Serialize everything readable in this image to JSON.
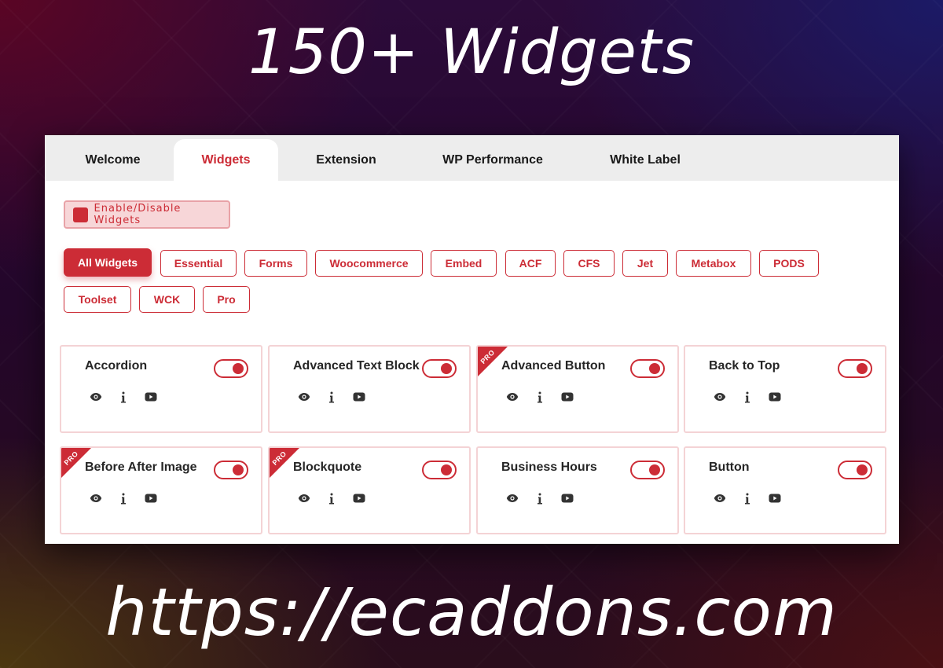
{
  "hero": {
    "title": "150+ Widgets",
    "url": "https://ecaddons.com"
  },
  "tabs": [
    {
      "label": "Welcome",
      "active": false
    },
    {
      "label": "Widgets",
      "active": true
    },
    {
      "label": "Extension",
      "active": false
    },
    {
      "label": "WP Performance",
      "active": false
    },
    {
      "label": "White Label",
      "active": false
    }
  ],
  "toolbar": {
    "enable_disable_label": "Enable/Disable Widgets"
  },
  "filters": [
    {
      "label": "All Widgets",
      "active": true
    },
    {
      "label": "Essential",
      "active": false
    },
    {
      "label": "Forms",
      "active": false
    },
    {
      "label": "Woocommerce",
      "active": false
    },
    {
      "label": "Embed",
      "active": false
    },
    {
      "label": "ACF",
      "active": false
    },
    {
      "label": "CFS",
      "active": false
    },
    {
      "label": "Jet",
      "active": false
    },
    {
      "label": "Metabox",
      "active": false
    },
    {
      "label": "PODS",
      "active": false
    },
    {
      "label": "Toolset",
      "active": false
    },
    {
      "label": "WCK",
      "active": false
    },
    {
      "label": "Pro",
      "active": false
    }
  ],
  "widgets": [
    {
      "name": "Accordion",
      "pro": false,
      "enabled": true
    },
    {
      "name": "Advanced Text Block",
      "pro": false,
      "enabled": true
    },
    {
      "name": "Advanced Button",
      "pro": true,
      "enabled": true
    },
    {
      "name": "Back to Top",
      "pro": false,
      "enabled": true
    },
    {
      "name": "Before After Image",
      "pro": true,
      "enabled": true
    },
    {
      "name": "Blockquote",
      "pro": true,
      "enabled": true
    },
    {
      "name": "Business Hours",
      "pro": false,
      "enabled": true
    },
    {
      "name": "Button",
      "pro": false,
      "enabled": true
    }
  ],
  "badge": {
    "pro_label": "PRO"
  },
  "icons": {
    "preview": "eye-icon",
    "info": "info-icon",
    "video": "youtube-icon"
  },
  "colors": {
    "accent": "#cc2c36",
    "accent_light": "#f7d6d8",
    "card_border": "#f4d3d5"
  }
}
